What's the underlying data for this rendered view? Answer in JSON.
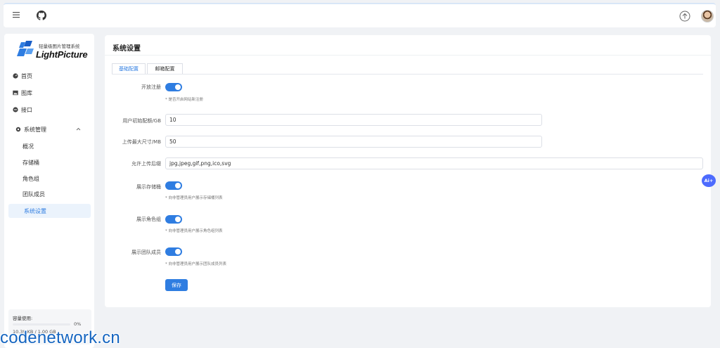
{
  "brand": {
    "subtitle": "轻量级图片管理系统",
    "name": "LightPicture"
  },
  "nav": {
    "home": "首页",
    "gallery": "图库",
    "api": "接口",
    "system": "系统管理",
    "sub": [
      "概况",
      "存储桶",
      "角色组",
      "团队成员",
      "系统设置"
    ]
  },
  "usage": {
    "label": "容量使用:",
    "percent_text": "0%",
    "percent": 0,
    "size_text": "10.39 KB / 1.00 GB"
  },
  "page": {
    "title": "系统设置"
  },
  "tabs": [
    "基础配置",
    "邮箱配置"
  ],
  "form": {
    "open_register": {
      "label": "开放注册",
      "hint": "* 是否开启网站新注册"
    },
    "quota": {
      "label": "用户初始配额/GB",
      "value": "10"
    },
    "max_size": {
      "label": "上传最大尺寸/MB",
      "value": "50"
    },
    "suffix": {
      "label": "允许上传后缀",
      "value": "jpg,jpeg,gif,png,ico,svg"
    },
    "show_storage": {
      "label": "展示存储桶",
      "hint": "* 向非管理员用户展示存储桶列表"
    },
    "show_roles": {
      "label": "展示角色组",
      "hint": "* 向非管理员用户展示角色组列表"
    },
    "show_team": {
      "label": "展示团队成员",
      "hint": "* 向非管理员用户展示团队成员列表"
    },
    "save_label": "保存"
  },
  "ai_button": "Ai+",
  "watermark": "codenetwork.cn",
  "colors": {
    "accent": "#2f7de1",
    "ai": "#4d6bfe"
  }
}
